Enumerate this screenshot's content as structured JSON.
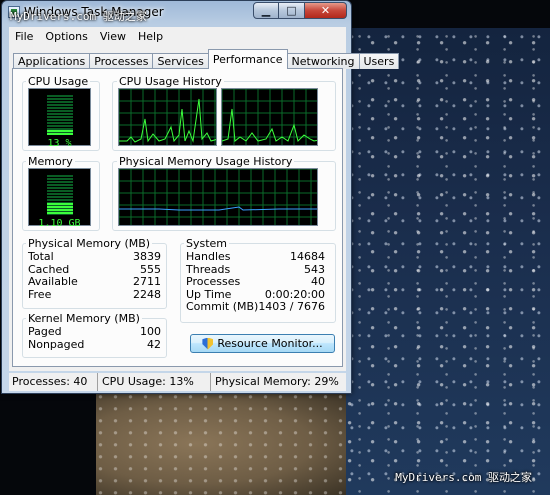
{
  "watermark": {
    "top": "MyDrivers.com 驱动之家",
    "bottom": "MyDrivers.com 驱动之家"
  },
  "window": {
    "title": "Windows Task Manager",
    "icon": "task-manager-icon",
    "caption_buttons": {
      "minimize": "▁",
      "maximize": "□",
      "close": "✕"
    }
  },
  "menu": [
    "File",
    "Options",
    "View",
    "Help"
  ],
  "tabs": [
    "Applications",
    "Processes",
    "Services",
    "Performance",
    "Networking",
    "Users"
  ],
  "active_tab": "Performance",
  "cpu_usage": {
    "label": "CPU Usage",
    "value": "13 %",
    "level": 0.13
  },
  "cpu_history": {
    "label": "CPU Usage History"
  },
  "memory": {
    "label": "Memory",
    "value": "1.10 GB",
    "level": 0.29
  },
  "memory_history": {
    "label": "Physical Memory Usage History"
  },
  "physical_memory": {
    "label": "Physical Memory (MB)",
    "rows": [
      {
        "name": "Total",
        "value": "3839"
      },
      {
        "name": "Cached",
        "value": "555"
      },
      {
        "name": "Available",
        "value": "2711"
      },
      {
        "name": "Free",
        "value": "2248"
      }
    ]
  },
  "kernel_memory": {
    "label": "Kernel Memory (MB)",
    "rows": [
      {
        "name": "Paged",
        "value": "100"
      },
      {
        "name": "Nonpaged",
        "value": "42"
      }
    ]
  },
  "system": {
    "label": "System",
    "rows": [
      {
        "name": "Handles",
        "value": "14684"
      },
      {
        "name": "Threads",
        "value": "543"
      },
      {
        "name": "Processes",
        "value": "40"
      },
      {
        "name": "Up Time",
        "value": "0:00:20:00"
      },
      {
        "name": "Commit (MB)",
        "value": "1403 / 7676"
      }
    ]
  },
  "resource_monitor_button": "Resource Monitor...",
  "status": {
    "processes": "Processes: 40",
    "cpu": "CPU Usage: 13%",
    "memory": "Physical Memory: 29%"
  },
  "colors": {
    "graph_line": "#3cff3c",
    "memory_line": "#3aa0ff",
    "grid": "#0a6a2a"
  }
}
